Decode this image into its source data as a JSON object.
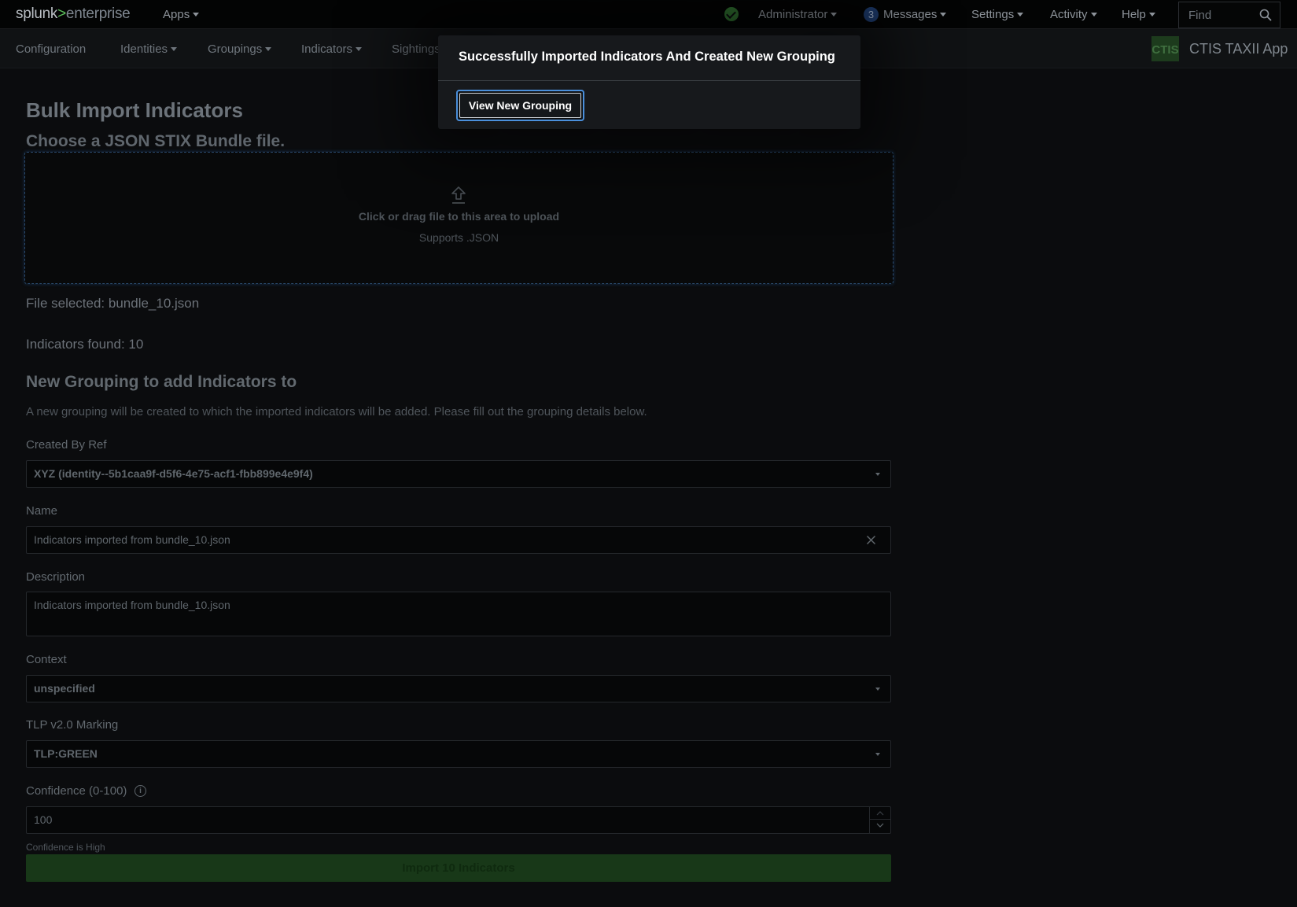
{
  "topbar": {
    "logo_splunk": "splunk",
    "logo_gt": ">",
    "logo_enterprise": "enterprise",
    "apps_label": "Apps",
    "user_label": "Administrator",
    "messages_count": "3",
    "messages_label": "Messages",
    "settings_label": "Settings",
    "activity_label": "Activity",
    "help_label": "Help",
    "find_placeholder": "Find"
  },
  "appnav": {
    "items": [
      "Configuration",
      "Identities",
      "Groupings",
      "Indicators",
      "Sightings"
    ],
    "app_badge": "CTIS",
    "app_name": "CTIS TAXII App"
  },
  "page": {
    "title": "Bulk Import Indicators",
    "subtitle": "Choose a JSON STIX Bundle file.",
    "dropzone_text": "Click or drag file to this area to upload",
    "dropzone_hint": "Supports .JSON",
    "file_selected": "File selected: bundle_10.json",
    "indicators_found": "Indicators found: 10",
    "section_title": "New Grouping to add Indicators to",
    "section_desc": "A new grouping will be created to which the imported indicators will be added. Please fill out the grouping details below."
  },
  "form": {
    "created_by_label": "Created By Ref",
    "created_by_value": "XYZ (identity--5b1caa9f-d5f6-4e75-acf1-fbb899e4e9f4)",
    "name_label": "Name",
    "name_value": "Indicators imported from bundle_10.json",
    "description_label": "Description",
    "description_value": "Indicators imported from bundle_10.json",
    "context_label": "Context",
    "context_value": "unspecified",
    "tlp_label": "TLP v2.0 Marking",
    "tlp_value": "TLP:GREEN",
    "confidence_label": "Confidence (0-100)",
    "confidence_value": "100",
    "confidence_helper": "Confidence is High",
    "import_label": "Import 10 Indicators"
  },
  "modal": {
    "title": "Successfully Imported Indicators And Created New Grouping",
    "button_label": "View New Grouping"
  },
  "colors": {
    "accent_blue": "#4a8fdb",
    "success_green": "#2e6b2e",
    "import_green": "#183818"
  }
}
